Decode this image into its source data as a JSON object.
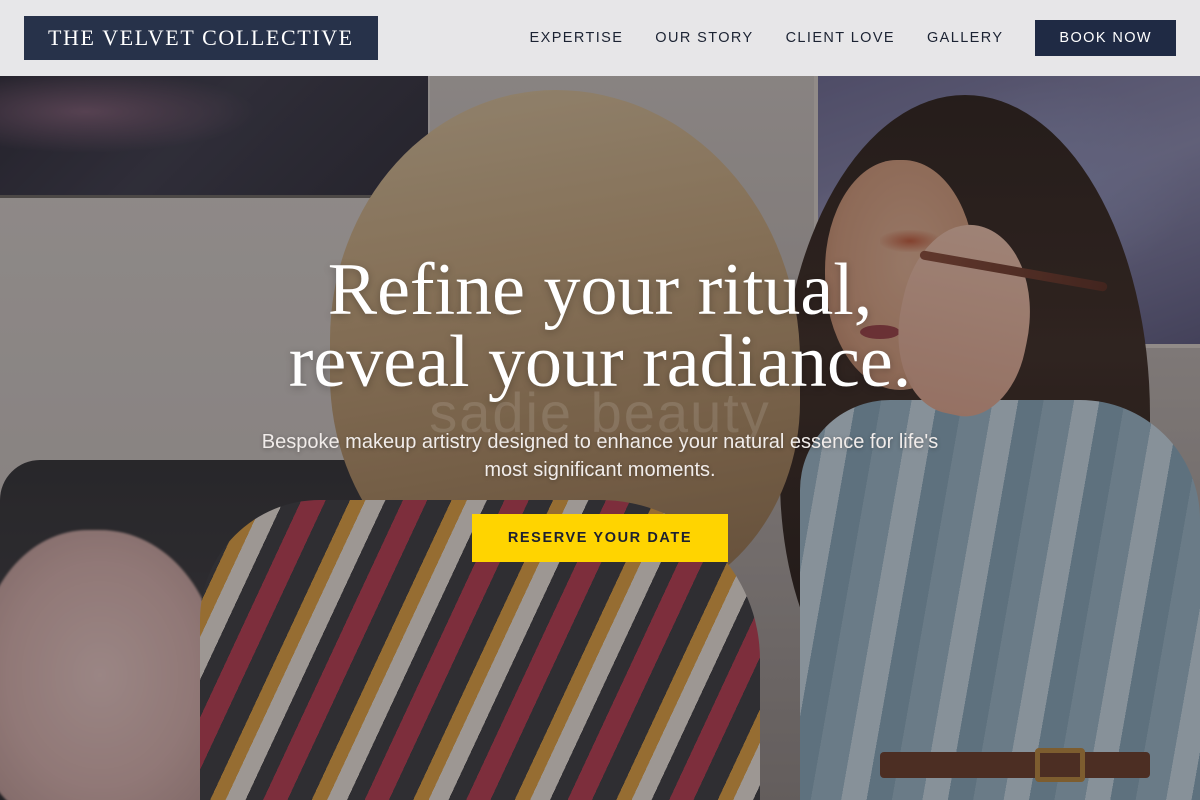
{
  "header": {
    "logo": "THE VELVET COLLECTIVE",
    "nav": [
      {
        "label": "EXPERTISE"
      },
      {
        "label": "OUR STORY"
      },
      {
        "label": "CLIENT LOVE"
      },
      {
        "label": "GALLERY"
      }
    ],
    "book_button": "BOOK NOW"
  },
  "hero": {
    "headline_line1": "Refine your ritual,",
    "headline_line2": "reveal your radiance.",
    "watermark": "sadie beauty",
    "subtext": "Bespoke makeup artistry designed to enhance your natural essence for life's most significant moments.",
    "cta": "RESERVE YOUR DATE",
    "image_description_icon": "makeup-photo-background"
  },
  "colors": {
    "header_bg": "#eeeef0",
    "brand_navy": "#27324a",
    "button_navy": "#1f2a44",
    "cta_yellow": "#ffd400"
  }
}
